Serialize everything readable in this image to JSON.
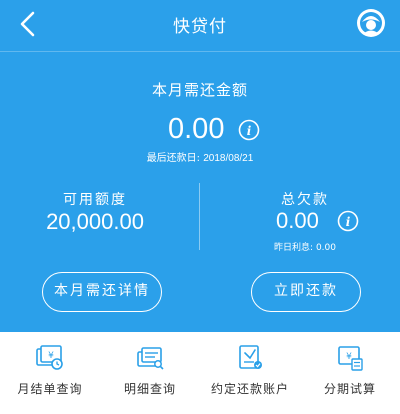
{
  "header": {
    "title": "快贷付",
    "back_icon": "chevron-left-icon",
    "avatar_icon": "profile-icon"
  },
  "due": {
    "title": "本月需还金额",
    "amount": "0.00",
    "last_date_label": "最后还款日:",
    "last_date": "2018/08/21"
  },
  "available": {
    "label": "可用额度",
    "amount": "20,000.00"
  },
  "owed": {
    "label": "总欠款",
    "amount": "0.00",
    "interest_label": "昨日利息:",
    "interest": "0.00"
  },
  "buttons": {
    "detail": "本月需还详情",
    "repay": "立即还款"
  },
  "tabs": [
    {
      "label": "月结单查询",
      "icon": "monthly-statement-icon"
    },
    {
      "label": "明细查询",
      "icon": "detail-query-icon"
    },
    {
      "label": "约定还款账户",
      "icon": "repay-account-icon"
    },
    {
      "label": "分期试算",
      "icon": "installment-calc-icon"
    }
  ],
  "colors": {
    "primary": "#2ba0ea",
    "icon_blue": "#2aa0e8",
    "text_dark": "#333333",
    "white": "#ffffff"
  }
}
